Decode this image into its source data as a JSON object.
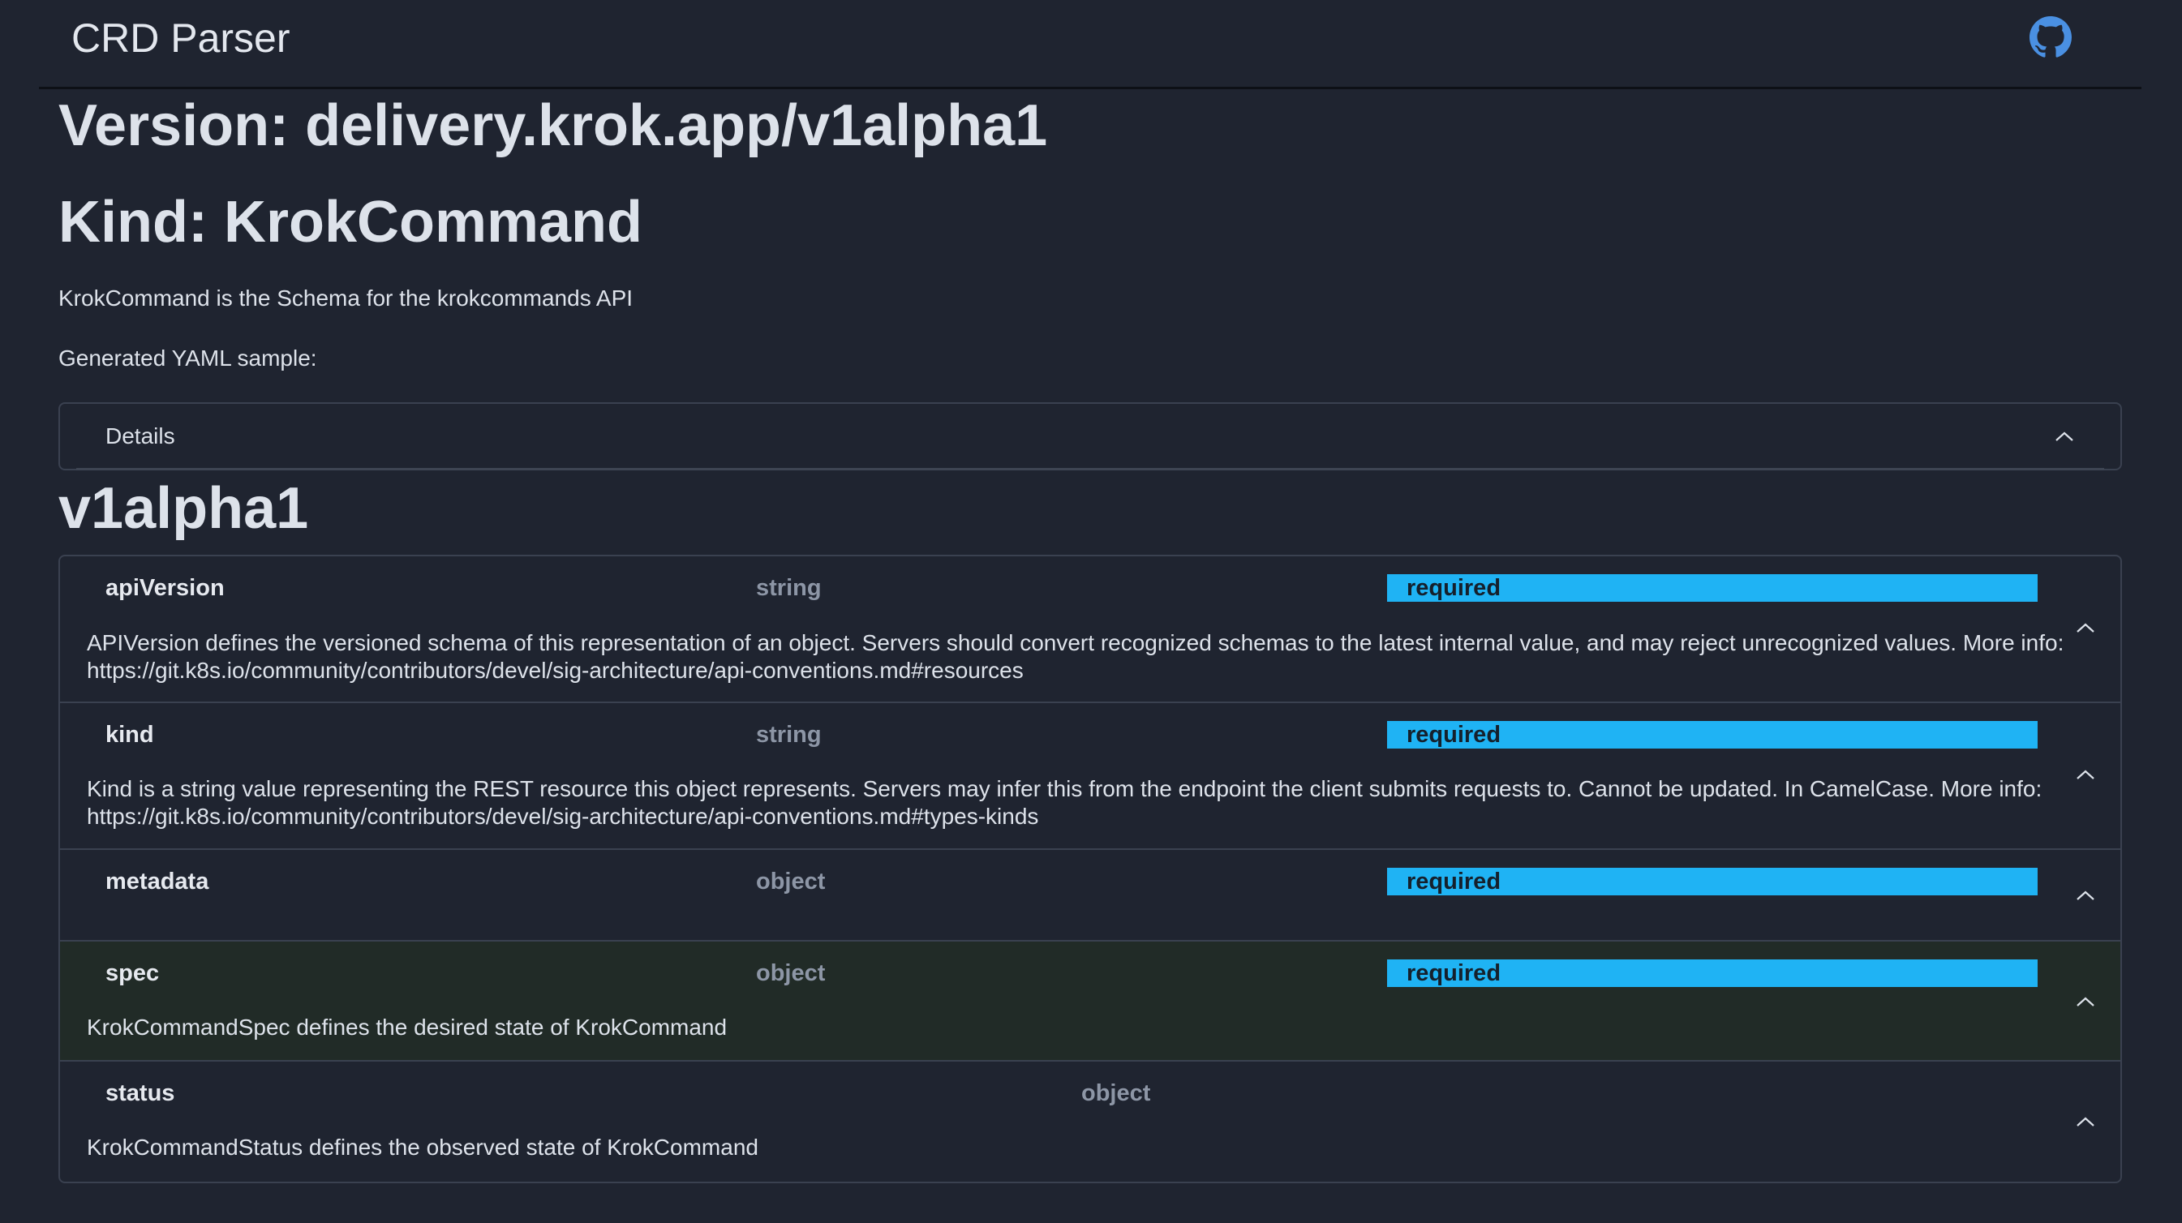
{
  "navbar": {
    "brand": "CRD Parser",
    "github_icon": "github-icon"
  },
  "header": {
    "version": "Version: delivery.krok.app/v1alpha1",
    "kind": "Kind: KrokCommand",
    "description": "KrokCommand is the Schema for the krokcommands API",
    "yaml_label": "Generated YAML sample:"
  },
  "details": {
    "label": "Details",
    "icon": "chevron-up-icon"
  },
  "schema_version": "v1alpha1",
  "fields": [
    {
      "name": "apiVersion",
      "type": "string",
      "required": "required",
      "description": "APIVersion defines the versioned schema of this representation of an object. Servers should convert recognized schemas to the latest internal value, and may reject unrecognized values. More info: https://git.k8s.io/community/contributors/devel/sig-architecture/api-conventions.md#resources"
    },
    {
      "name": "kind",
      "type": "string",
      "required": "required",
      "description": "Kind is a string value representing the REST resource this object represents. Servers may infer this from the endpoint the client submits requests to. Cannot be updated. In CamelCase. More info: https://git.k8s.io/community/contributors/devel/sig-architecture/api-conventions.md#types-kinds"
    },
    {
      "name": "metadata",
      "type": "object",
      "required": "required",
      "description": ""
    },
    {
      "name": "spec",
      "type": "object",
      "required": "required",
      "description": "KrokCommandSpec defines the desired state of KrokCommand"
    },
    {
      "name": "status",
      "type": "object",
      "required": "",
      "description": "KrokCommandStatus defines the observed state of KrokCommand"
    }
  ],
  "colors": {
    "background": "#1f2430",
    "required_badge": "#1fb3f4",
    "highlight_row": "#212b27",
    "border": "#3a4150"
  }
}
